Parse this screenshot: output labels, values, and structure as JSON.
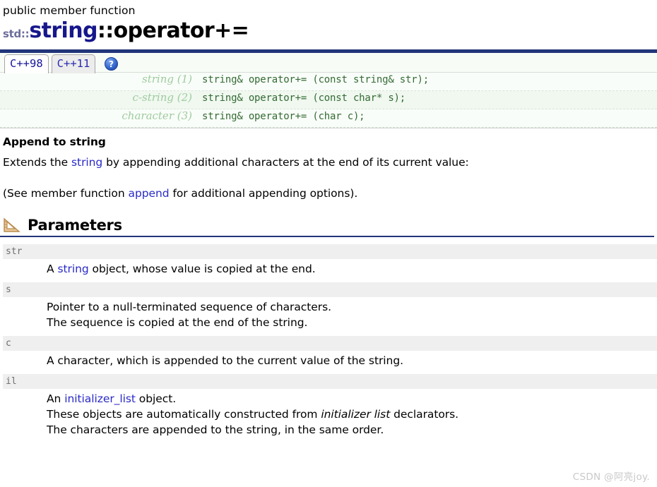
{
  "header": {
    "kind": "public member function",
    "title_namespace": "std::",
    "title_class": "string",
    "title_member": "::operator+="
  },
  "tabs": {
    "items": [
      {
        "label": "C++98",
        "active": true
      },
      {
        "label": "C++11",
        "active": false
      }
    ],
    "help_icon": "help-question-icon",
    "help_glyph": "?"
  },
  "signatures": [
    {
      "label": "string (1)",
      "code": "string& operator+= (const string& str);"
    },
    {
      "label": "c-string (2)",
      "code": "string& operator+= (const char* s);"
    },
    {
      "label": "character (3)",
      "code": "string& operator+= (char c);"
    }
  ],
  "description": {
    "heading": "Append to string",
    "para1_pre": "Extends the ",
    "para1_link": "string",
    "para1_post": " by appending additional characters at the end of its current value:",
    "para2_pre": "(See member function ",
    "para2_link": "append",
    "para2_post": " for additional appending options)."
  },
  "parameters_section": {
    "icon": "set-square-ruler-icon",
    "title": "Parameters",
    "items": [
      {
        "name": "str",
        "lines": [
          {
            "pre": "A ",
            "link": "string",
            "post": " object, whose value is copied at the end."
          }
        ]
      },
      {
        "name": "s",
        "lines": [
          {
            "pre": "Pointer to a null-terminated sequence of characters.",
            "link": "",
            "post": ""
          },
          {
            "pre": "The sequence is copied at the end of the string.",
            "link": "",
            "post": ""
          }
        ]
      },
      {
        "name": "c",
        "lines": [
          {
            "pre": "A character, which is appended to the current value of the string.",
            "link": "",
            "post": ""
          }
        ]
      },
      {
        "name": "il",
        "lines": [
          {
            "pre": "An ",
            "link": "initializer_list",
            "post": " object."
          },
          {
            "pre": "These objects are automatically constructed from ",
            "italic": "initializer list",
            "post": " declarators."
          },
          {
            "pre": "The characters are appended to the string, in the same order.",
            "link": "",
            "post": ""
          }
        ]
      }
    ]
  },
  "watermark": {
    "text": "CSDN @阿亮joy."
  },
  "colors": {
    "rule_navy": "#22357a",
    "class_navy": "#17178c",
    "link_blue": "#2a2ac8",
    "sig_green": "#356b35",
    "sig_label_green": "#9fcb9f",
    "param_band": "#efefef",
    "tab_active_bg": "#ffffff",
    "tab_inactive_bg": "#ececec"
  }
}
